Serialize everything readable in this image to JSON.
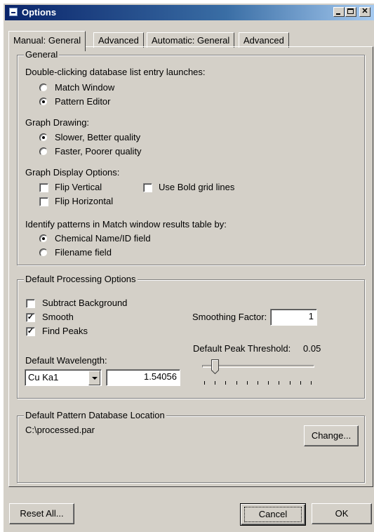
{
  "window": {
    "title": "Options"
  },
  "tabs": [
    {
      "label": "Manual: General"
    },
    {
      "label": "Advanced"
    },
    {
      "label": "Automatic: General"
    },
    {
      "label": "Advanced"
    }
  ],
  "general": {
    "legend": "General",
    "dblclick_label": "Double-clicking database list entry launches:",
    "dblclick_options": [
      {
        "label": "Match Window",
        "selected": false
      },
      {
        "label": "Pattern Editor",
        "selected": true
      }
    ],
    "graph_drawing_label": "Graph Drawing:",
    "graph_drawing_options": [
      {
        "label": "Slower, Better quality",
        "selected": true
      },
      {
        "label": "Faster, Poorer quality",
        "selected": false
      }
    ],
    "graph_display_label": "Graph Display Options:",
    "flip_vertical": {
      "label": "Flip Vertical",
      "checked": false
    },
    "bold_grid": {
      "label": "Use Bold grid lines",
      "checked": false
    },
    "flip_horizontal": {
      "label": "Flip Horizontal",
      "checked": false
    },
    "identify_label": "Identify patterns in Match window results table by:",
    "identify_options": [
      {
        "label": "Chemical Name/ID field",
        "selected": true
      },
      {
        "label": "Filename field",
        "selected": false
      }
    ]
  },
  "processing": {
    "legend": "Default Processing Options",
    "subtract_background": {
      "label": "Subtract Background",
      "checked": false
    },
    "smooth": {
      "label": "Smooth",
      "checked": true
    },
    "find_peaks": {
      "label": "Find Peaks",
      "checked": true
    },
    "smoothing_factor_label": "Smoothing Factor:",
    "smoothing_factor_value": "1",
    "peak_threshold_label": "Default Peak Threshold:",
    "peak_threshold_value": "0.05",
    "peak_threshold_level": 0.1,
    "wavelength_label": "Default Wavelength:",
    "wavelength_select": "Cu Ka1",
    "wavelength_value": "1.54056"
  },
  "database": {
    "legend": "Default Pattern Database Location",
    "path": "C:\\processed.par",
    "change_label": "Change..."
  },
  "footer": {
    "reset_label": "Reset All...",
    "cancel_label": "Cancel",
    "ok_label": "OK"
  },
  "colors": {
    "titlebar_start": "#0a246a",
    "titlebar_end": "#a6caf0",
    "face": "#d4d0c8"
  }
}
